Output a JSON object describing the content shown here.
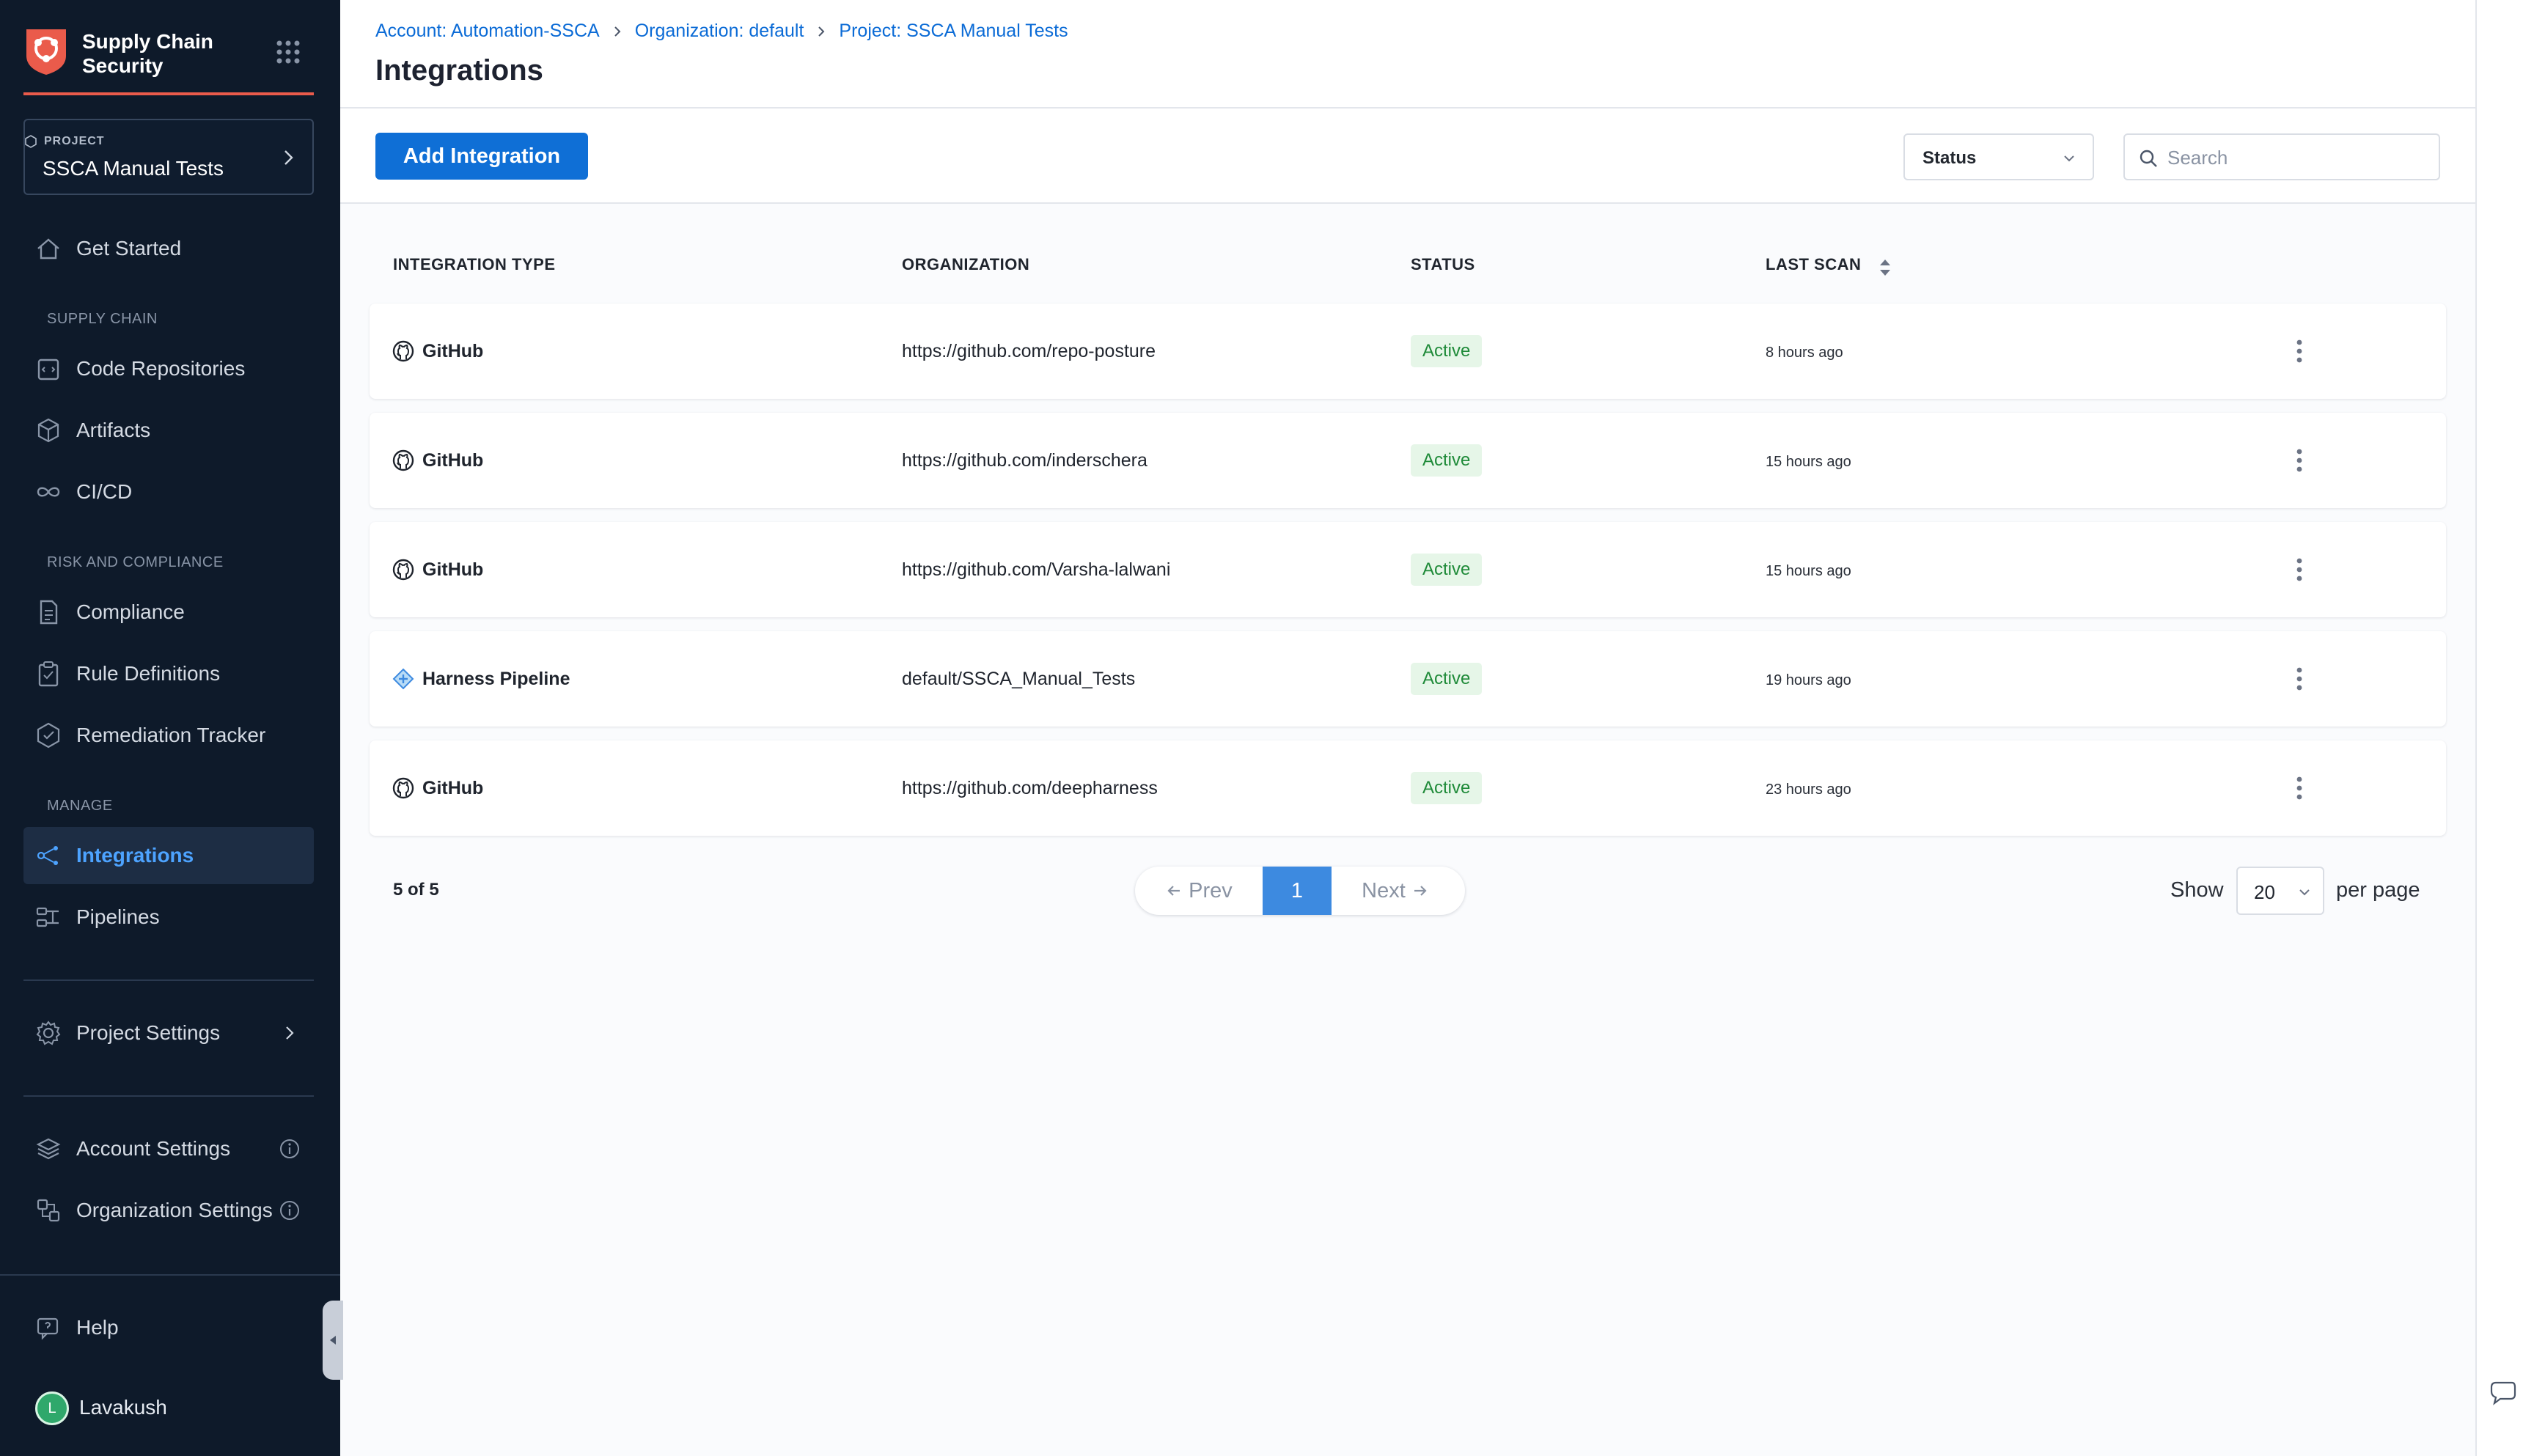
{
  "app": {
    "title": "Supply Chain Security",
    "icons": {
      "logo": "harness-ssca-logo",
      "apps": "apps-grid-icon"
    },
    "accent": "#ea5b4b"
  },
  "project": {
    "kicker": "PROJECT",
    "name": "SSCA Manual Tests"
  },
  "sidebar": {
    "get_started": "Get Started",
    "sections": {
      "supply_chain": "SUPPLY CHAIN",
      "risk": "RISK AND COMPLIANCE",
      "manage": "MANAGE"
    },
    "items": [
      {
        "label": "Code Repositories",
        "icon": "code-repo-icon"
      },
      {
        "label": "Artifacts",
        "icon": "artifact-cube-icon"
      },
      {
        "label": "CI/CD",
        "icon": "infinity-icon"
      },
      {
        "label": "Compliance",
        "icon": "document-icon"
      },
      {
        "label": "Rule Definitions",
        "icon": "clipboard-icon"
      },
      {
        "label": "Remediation Tracker",
        "icon": "remediation-icon"
      },
      {
        "label": "Integrations",
        "icon": "integrations-icon",
        "active": true
      },
      {
        "label": "Pipelines",
        "icon": "pipeline-icon"
      }
    ],
    "project_settings": "Project Settings",
    "account_settings": "Account Settings",
    "organization_settings": "Organization Settings",
    "help": "Help",
    "user": {
      "initial": "L",
      "name": "Lavakush"
    },
    "active_color": "#4da3ff"
  },
  "breadcrumbs": [
    "Account: Automation-SSCA",
    "Organization: default",
    "Project: SSCA Manual Tests"
  ],
  "page": {
    "title": "Integrations"
  },
  "toolbar": {
    "add_button": "Add Integration",
    "status_filter": "Status",
    "search_placeholder": "Search"
  },
  "table": {
    "columns": [
      "INTEGRATION TYPE",
      "ORGANIZATION",
      "STATUS",
      "LAST SCAN"
    ],
    "rows": [
      {
        "type": "GitHub",
        "icon": "github-icon",
        "organization": "https://github.com/repo-posture",
        "status": "Active",
        "last_scan": "8 hours ago"
      },
      {
        "type": "GitHub",
        "icon": "github-icon",
        "organization": "https://github.com/inderschera",
        "status": "Active",
        "last_scan": "15 hours ago"
      },
      {
        "type": "GitHub",
        "icon": "github-icon",
        "organization": "https://github.com/Varsha-lalwani",
        "status": "Active",
        "last_scan": "15 hours ago"
      },
      {
        "type": "Harness Pipeline",
        "icon": "harness-pipeline-icon",
        "organization": "default/SSCA_Manual_Tests",
        "status": "Active",
        "last_scan": "19 hours ago"
      },
      {
        "type": "GitHub",
        "icon": "github-icon",
        "organization": "https://github.com/deepharness",
        "status": "Active",
        "last_scan": "23 hours ago"
      }
    ],
    "status_color": "#1e8a38"
  },
  "pagination": {
    "summary": "5 of 5",
    "prev": "Prev",
    "current": "1",
    "next": "Next",
    "show_label": "Show",
    "per_page_value": "20",
    "per_page_label": "per page"
  }
}
